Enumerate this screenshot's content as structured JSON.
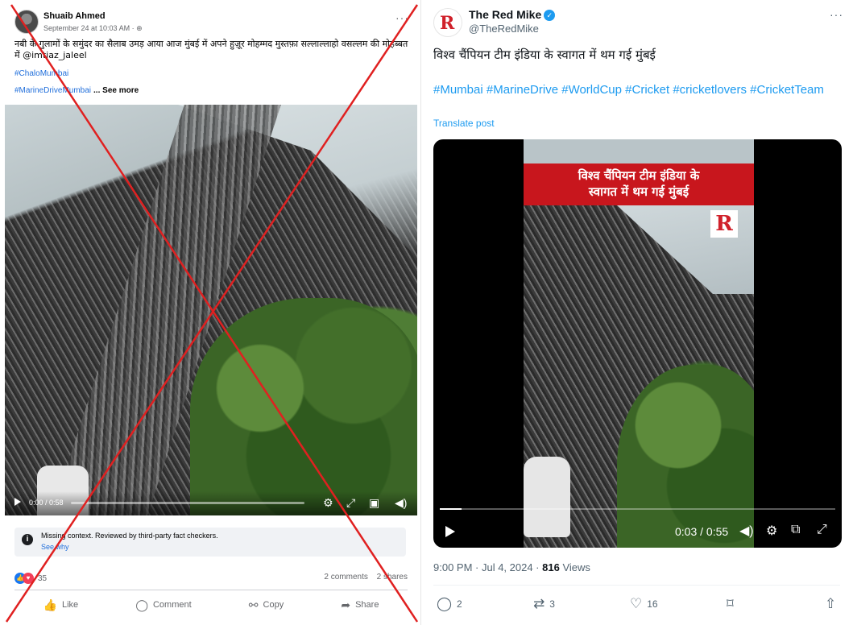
{
  "facebook_post": {
    "author": "Shuaib Ahmed",
    "date": "September 24 at 10:03 AM · ",
    "privacy_icon": "globe-icon",
    "more_label": "···",
    "text": "नबी के गुलामों के समुंदर का सैलाब उमड़ आया आज मुंबई में अपने हुज़ूर मोहम्मद मुस्तफ़ा सल्लाल्लाहो वसल्लम की मोहब्बत में @imtiaz_jaleel",
    "hashtag_1": "#ChaloMumbai",
    "hashtag_2": "#MarineDriveMumbai",
    "see_more": "... See more",
    "video": {
      "time": "0:00 / 0:58",
      "progress_fraction": 0.0
    },
    "notice": {
      "text": "Missing context. Reviewed by third-party fact checkers.",
      "link": "See why"
    },
    "reactions_count": "35",
    "comments": "2 comments",
    "shares": "2 shares",
    "actions": {
      "like": "Like",
      "comment": "Comment",
      "copy": "Copy",
      "share": "Share"
    },
    "cross_color": "#e02020"
  },
  "x_post": {
    "display_name": "The Red Mike",
    "handle": "@TheRedMike",
    "more_label": "···",
    "text": "विश्व चैंपियन टीम इंडिया के स्वागत में थम गई मुंबई",
    "hashtags": "#Mumbai #MarineDrive #WorldCup #Cricket #cricketlovers #CricketTeam",
    "translate": "Translate post",
    "video": {
      "banner_line_1": "विश्व चैंपियन टीम इंडिया के",
      "banner_line_2": "स्वागत में थम गई मुंबई",
      "time": "0:03 / 0:55",
      "progress_fraction": 0.055
    },
    "timestamp": "9:00 PM · Jul 4, 2024 · ",
    "views_count": "816",
    "views_label": " Views",
    "replies": "2",
    "reposts": "3",
    "likes": "16",
    "accent_color": "#1d9bf0",
    "brand_color": "#d0202a"
  }
}
